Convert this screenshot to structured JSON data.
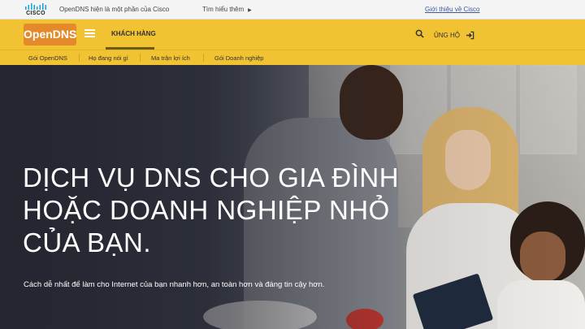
{
  "cisco_bar": {
    "logo_word": "CISCO",
    "tagline": "OpenDNS hiện là một phần của Cisco",
    "learn_more": "Tìm hiểu thêm",
    "about_cisco": "Giới thiệu về Cisco"
  },
  "main_nav": {
    "logo": "OpenDNS",
    "customer_tab": "KHÁCH HÀNG",
    "support": "ỦNG HỘ"
  },
  "sub_nav": {
    "items": [
      "Gói OpenDNS",
      "Họ đang nói gì",
      "Ma trận lợi ích",
      "Gói Doanh nghiệp"
    ]
  },
  "hero": {
    "headline_lines": [
      "DỊCH VỤ DNS CHO GIA ĐÌNH",
      "HOẶC DOANH NGHIỆP NHỎ",
      "CỦA BẠN."
    ],
    "subline": "Cách dễ nhất để làm cho Internet của bạn nhanh hơn, an toàn hơn và đáng tin cậy hơn."
  },
  "colors": {
    "brand_yellow": "#f1c232",
    "logo_orange": "#e58a2b",
    "link_blue": "#3c5a9a"
  }
}
